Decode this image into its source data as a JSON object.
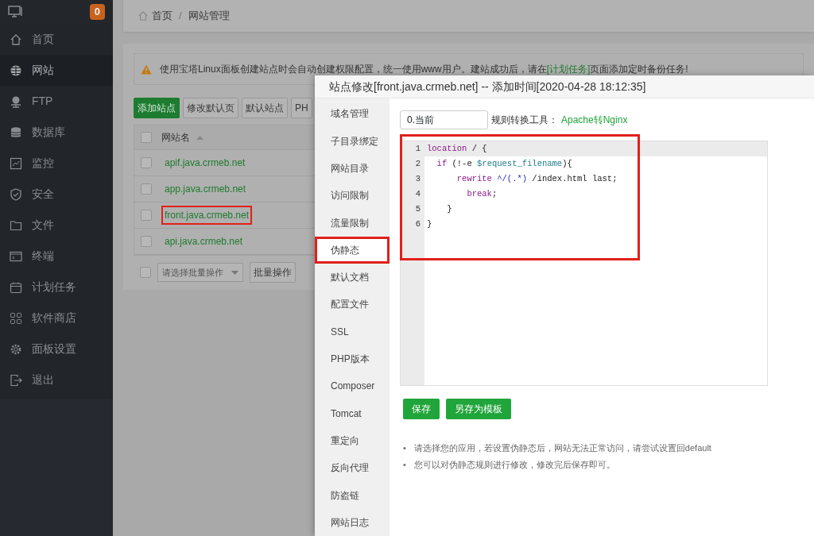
{
  "sidebar": {
    "badge": "0",
    "items": [
      {
        "label": "首页",
        "selected": false
      },
      {
        "label": "网站",
        "selected": true
      },
      {
        "label": "FTP",
        "selected": false
      },
      {
        "label": "数据库",
        "selected": false
      },
      {
        "label": "监控",
        "selected": false
      },
      {
        "label": "安全",
        "selected": false
      },
      {
        "label": "文件",
        "selected": false
      },
      {
        "label": "终端",
        "selected": false
      },
      {
        "label": "计划任务",
        "selected": false
      },
      {
        "label": "软件商店",
        "selected": false
      },
      {
        "label": "面板设置",
        "selected": false
      },
      {
        "label": "退出",
        "selected": false
      }
    ]
  },
  "breadcrumb": [
    "首页",
    "/",
    "网站管理"
  ],
  "alert": {
    "before": "使用宝塔Linux面板创建站点时会自动创建权限配置，统一使用www用户。建站成功后，请在",
    "link": "[计划任务]",
    "after": "页面添加定时备份任务!"
  },
  "toolbar": [
    {
      "label": "添加站点",
      "kind": "primary"
    },
    {
      "label": "修改默认页",
      "kind": "default"
    },
    {
      "label": "默认站点",
      "kind": "default"
    },
    {
      "label": "PH",
      "kind": "default"
    }
  ],
  "table": {
    "header_checked": false,
    "columns": [
      "网站名"
    ],
    "rows": [
      {
        "name": "apif.java.crmeb.net",
        "checked": false,
        "highlighted": false
      },
      {
        "name": "app.java.crmeb.net",
        "checked": false,
        "highlighted": false
      },
      {
        "name": "front.java.crmeb.net",
        "checked": false,
        "highlighted": true
      },
      {
        "name": "api.java.crmeb.net",
        "checked": false,
        "highlighted": false
      }
    ]
  },
  "batch": {
    "checked": false,
    "placeholder": "请选择批量操作",
    "button": "批量操作"
  },
  "modal": {
    "title": "站点修改[front.java.crmeb.net] -- 添加时间[2020-04-28 18:12:35]",
    "tabs": [
      {
        "label": "域名管理",
        "selected": false,
        "highlighted": false
      },
      {
        "label": "子目录绑定",
        "selected": false,
        "highlighted": false
      },
      {
        "label": "网站目录",
        "selected": false,
        "highlighted": false
      },
      {
        "label": "访问限制",
        "selected": false,
        "highlighted": false
      },
      {
        "label": "流量限制",
        "selected": false,
        "highlighted": false
      },
      {
        "label": "伪静态",
        "selected": true,
        "highlighted": true
      },
      {
        "label": "默认文档",
        "selected": false,
        "highlighted": false
      },
      {
        "label": "配置文件",
        "selected": false,
        "highlighted": false
      },
      {
        "label": "SSL",
        "selected": false,
        "highlighted": false
      },
      {
        "label": "PHP版本",
        "selected": false,
        "highlighted": false
      },
      {
        "label": "Composer",
        "selected": false,
        "highlighted": false
      },
      {
        "label": "Tomcat",
        "selected": false,
        "highlighted": false
      },
      {
        "label": "重定向",
        "selected": false,
        "highlighted": false
      },
      {
        "label": "反向代理",
        "selected": false,
        "highlighted": false
      },
      {
        "label": "防盗链",
        "selected": false,
        "highlighted": false
      },
      {
        "label": "网站日志",
        "selected": false,
        "highlighted": false
      }
    ],
    "template_select": "0.当前",
    "tool_label": "规则转换工具：",
    "tool_link": "Apache转Nginx",
    "editor": {
      "highlighted": true,
      "lines": [
        {
          "number": "1",
          "tokens": [
            {
              "text": "location",
              "kind": "keyword"
            },
            {
              "text": " / {",
              "kind": "plain"
            }
          ]
        },
        {
          "number": "2",
          "tokens": [
            {
              "text": "  if",
              "kind": "keyword"
            },
            {
              "text": " (!-e ",
              "kind": "plain"
            },
            {
              "text": "$request_filename",
              "kind": "variable"
            },
            {
              "text": "){",
              "kind": "plain"
            }
          ]
        },
        {
          "number": "3",
          "tokens": [
            {
              "text": "      rewrite",
              "kind": "keyword"
            },
            {
              "text": " ^/(.*)",
              "kind": "regex"
            },
            {
              "text": " /index.html last;",
              "kind": "plain"
            }
          ]
        },
        {
          "number": "4",
          "tokens": [
            {
              "text": "        break",
              "kind": "keyword"
            },
            {
              "text": ";",
              "kind": "plain"
            }
          ]
        },
        {
          "number": "5",
          "tokens": [
            {
              "text": "    }",
              "kind": "plain"
            }
          ]
        },
        {
          "number": "6",
          "tokens": [
            {
              "text": "}",
              "kind": "plain"
            }
          ]
        }
      ]
    },
    "buttons": [
      "保存",
      "另存为模板"
    ],
    "notes": [
      {
        "bullet": "•",
        "text": "请选择您的应用，若设置伪静态后，网站无法正常访问，请尝试设置回default"
      },
      {
        "bullet": "•",
        "text": "您可以对伪静态规则进行修改，修改完后保存即可。"
      }
    ]
  }
}
